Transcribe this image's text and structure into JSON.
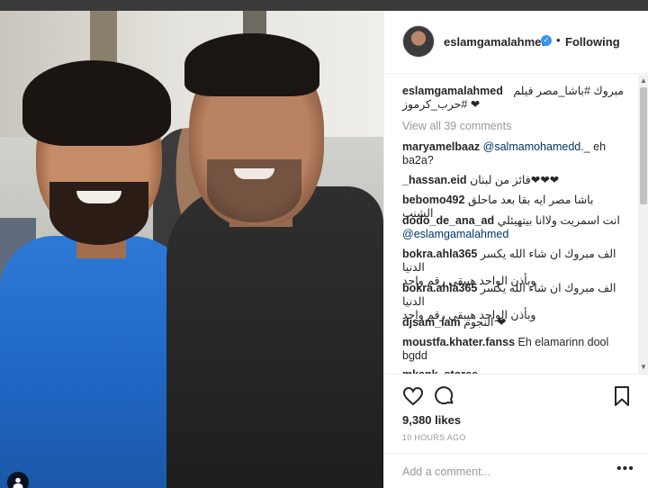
{
  "post": {
    "username": "eslamgamalahmed",
    "follow_state": "Following",
    "dot": "•",
    "verified_mark": "✓",
    "likes": "9,380 likes",
    "time": "10 HOURS AGO",
    "add_comment_placeholder": "Add a comment...",
    "more_label": "•••"
  },
  "caption": {
    "username": "eslamgamalahmed",
    "text": "مبروك  #باشا_مصر فيلم",
    "text2": "❤ #حرب_كرموز"
  },
  "view_all": "View all 39 comments",
  "comments": [
    {
      "user": "maryamelbaaz",
      "mention": "@salmamohamedd._",
      "text": "eh ba2a?"
    },
    {
      "user": "_hassan.eid",
      "text": "❤❤❤فائز من لبنان"
    },
    {
      "user": "bebomo492",
      "text": "باشا مصر ايه بقا بعد ماحلق الشنب"
    },
    {
      "user": "dodo_de_ana_ad",
      "text": "انت اسمريت ولاانا بيتهيئلي",
      "mention": "@eslamgamalahmed"
    },
    {
      "user": "bokra.ahla365",
      "text": "الف مبروك ان شاء الله يكسر الدنيا",
      "text2": "وبأذن الواحد هيبقى رقم واحد"
    },
    {
      "user": "bokra.ahla365",
      "text": "الف مبروك ان شاء الله يكسر الدنيا",
      "text2": "وبأذن الواحد هيبقى رقم واحد"
    },
    {
      "user": "djsam_iam",
      "text": "❤ النجوم"
    },
    {
      "user": "moustfa.khater.fanss",
      "text": "Eh elamarinn dool bgdd"
    },
    {
      "user": "mkank_storee",
      "text": ""
    }
  ],
  "icons": {
    "like": "heart-icon",
    "comment": "comment-icon",
    "save": "bookmark-icon",
    "user_tag": "user-icon"
  },
  "colors": {
    "verified": "#3897f0",
    "mention": "#003569",
    "muted": "#999999",
    "text": "#262626"
  }
}
